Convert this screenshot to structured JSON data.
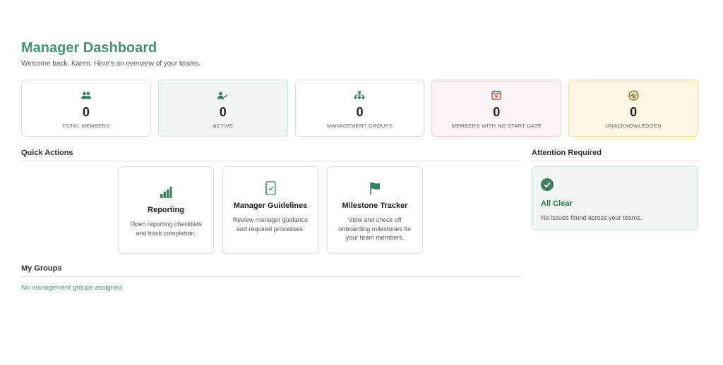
{
  "header": {
    "title": "Manager Dashboard",
    "subtitle": "Welcome back, Karen. Here's an overview of your teams."
  },
  "stats": [
    {
      "value": "0",
      "label": "TOTAL MEMBERS",
      "icon": "users-icon",
      "tone": "default"
    },
    {
      "value": "0",
      "label": "ACTIVE",
      "icon": "user-check-icon",
      "tone": "green"
    },
    {
      "value": "0",
      "label": "MANAGEMENT GROUPS",
      "icon": "sitemap-icon",
      "tone": "default"
    },
    {
      "value": "0",
      "label": "MEMBERS WITH NO START DATE",
      "icon": "calendar-x-icon",
      "tone": "red"
    },
    {
      "value": "0",
      "label": "UNACKNOWLEDGED",
      "icon": "signature-icon",
      "tone": "amber"
    }
  ],
  "quick_actions": {
    "heading": "Quick Actions",
    "items": [
      {
        "title": "Reporting",
        "description": "Open reporting checklists and track completion.",
        "icon": "bar-chart-icon"
      },
      {
        "title": "Manager Guidelines",
        "description": "Review manager guidance and required processes.",
        "icon": "notebook-check-icon"
      },
      {
        "title": "Milestone Tracker",
        "description": "View and check off onboarding milestones for your team members.",
        "icon": "flag-icon"
      }
    ]
  },
  "attention": {
    "heading": "Attention Required",
    "status_title": "All Clear",
    "status_desc": "No issues found across your teams.",
    "icon": "check-circle-icon"
  },
  "groups": {
    "heading": "My Groups",
    "empty_text": "No management groups assigned."
  },
  "colors": {
    "accent": "#4a8f73",
    "icon_green": "#3e7d5f",
    "red": "#c0392b",
    "amber": "#8a6a10"
  }
}
